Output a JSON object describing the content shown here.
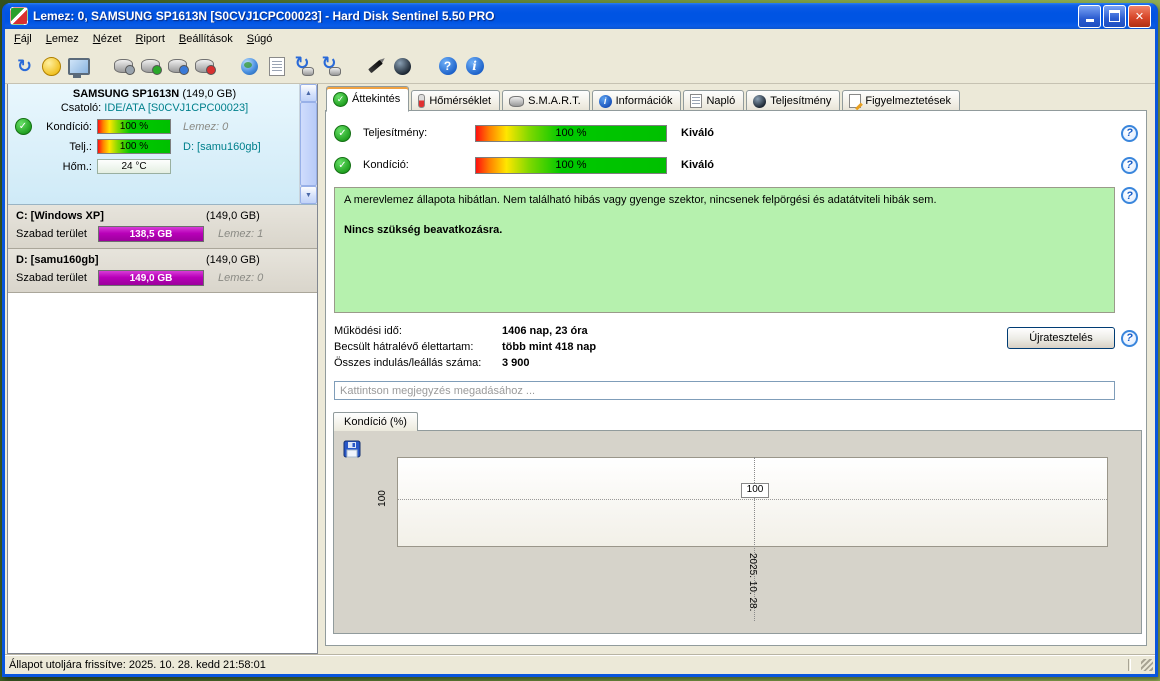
{
  "window": {
    "title": "Lemez: 0, SAMSUNG SP1613N [S0CVJ1CPC00023]  -  Hard Disk Sentinel 5.50 PRO"
  },
  "menubar": {
    "items": [
      "Fájl",
      "Lemez",
      "Nézet",
      "Riport",
      "Beállítások",
      "Súgó"
    ]
  },
  "sidebar": {
    "disk_name": "SAMSUNG SP1613N",
    "disk_size": "(149,0 GB)",
    "interface_label": "Csatoló:",
    "interface_value": "IDE/ATA [S0CVJ1CPC00023]",
    "condition_label": "Kondíció:",
    "condition_value": "100 %",
    "performance_label": "Telj.:",
    "performance_value": "100 %",
    "temperature_label": "Hőm.:",
    "temperature_value": "24 °C",
    "disk_number": "Lemez: 0",
    "volume": "D: [samu160gb]",
    "partitions": [
      {
        "name": "C: [Windows XP]",
        "size": "(149,0 GB)",
        "free_label": "Szabad terület",
        "free_value": "138,5 GB",
        "disk": "Lemez: 1"
      },
      {
        "name": "D: [samu160gb]",
        "size": "(149,0 GB)",
        "free_label": "Szabad terület",
        "free_value": "149,0 GB",
        "disk": "Lemez: 0"
      }
    ]
  },
  "tabs": [
    {
      "label": "Áttekintés"
    },
    {
      "label": "Hőmérséklet"
    },
    {
      "label": "S.M.A.R.T."
    },
    {
      "label": "Információk"
    },
    {
      "label": "Napló"
    },
    {
      "label": "Teljesítmény"
    },
    {
      "label": "Figyelmeztetések"
    }
  ],
  "overview": {
    "performance_label": "Teljesítmény:",
    "performance_value": "100 %",
    "performance_rating": "Kiváló",
    "condition_label": "Kondíció:",
    "condition_value": "100 %",
    "condition_rating": "Kiváló",
    "status_text": "A merevlemez állapota hibátlan. Nem található hibás vagy gyenge szektor, nincsenek felpörgési és adatátviteli hibák sem.",
    "status_advice": "Nincs szükség beavatkozásra.",
    "stats": [
      {
        "label": "Működési idő:",
        "value": "1406 nap, 23 óra"
      },
      {
        "label": "Becsült hátralévő élettartam:",
        "value": "több mint 418 nap"
      },
      {
        "label": "Összes indulás/leállás száma:",
        "value": "3 900"
      }
    ],
    "retest_button": "Újratesztelés",
    "comment_placeholder": "Kattintson megjegyzés megadásához ..."
  },
  "chart_data": {
    "type": "line",
    "title": "Kondíció  (%)",
    "x": [
      "2025. 10. 28."
    ],
    "series": [
      {
        "name": "Kondíció",
        "values": [
          100
        ]
      }
    ],
    "ylabel_tick": "100",
    "point_label": "100",
    "ylim": [
      0,
      100
    ],
    "grid": "dotted",
    "legend": "none"
  },
  "statusbar": {
    "text": "Állapot utoljára frissítve: 2025. 10. 28. kedd 21:58:01"
  },
  "colors": {
    "titlebar_blue": "#0054e3",
    "free_space_bar_magenta": "#cc00cc",
    "status_box_green": "#b6f1ae",
    "gauge_gradient": [
      "#ff1010",
      "#ffe600",
      "#00c000"
    ],
    "teal_text": "#00808c"
  },
  "glyphs": {
    "check": "✓",
    "question": "?",
    "info": "i",
    "up_arrow": "▲",
    "down_arrow": "▼",
    "close": "✕",
    "refresh": "↻"
  }
}
